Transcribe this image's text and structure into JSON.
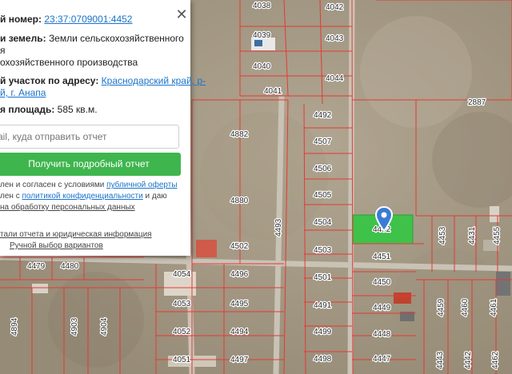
{
  "panel": {
    "cadastral_label": "й номер:",
    "cadastral_value": "23:37:0709001:4452",
    "category_label": "и земель:",
    "category_value_1": "Земли сельскохозяйственного",
    "category_value_2": "я",
    "use_value": "охозяйственного производства",
    "address_label": "й участок по адресу:",
    "address_value_1": "Краснодарский край, р-",
    "address_value_2": "й, г. Анапа",
    "area_label": "я площадь:",
    "area_value": "585 кв.м.",
    "email_placeholder": "ail, куда отправить отчет",
    "submit_label": "Получить подробный отчет",
    "consent_1a": "лен и согласен с условиями ",
    "consent_1b": "публичной оферты",
    "consent_2a": "лен с ",
    "consent_2b": "политикой конфиденциальности",
    "consent_2c": " и даю",
    "consent_3": "на обработку персональных данных",
    "details_link": "тали отчета и юридическая информация",
    "manual_link": "Ручной выбор вариантов"
  },
  "map": {
    "highlight_color": "#3ec24a",
    "boundary_color": "#e53935",
    "parcels": [
      "4038",
      "4042",
      "4039",
      "4043",
      "4040",
      "4044",
      "4041",
      "2887",
      "4492",
      "4882",
      "4507",
      "4506",
      "4880",
      "4505",
      "4504",
      "4452",
      "4502",
      "4493",
      "4503",
      "4451",
      "4453",
      "4431",
      "4455",
      "4479",
      "4480",
      "4054",
      "4496",
      "4501",
      "4450",
      "4053",
      "4495",
      "4491",
      "4449",
      "4459",
      "4460",
      "4461",
      "4894",
      "4903",
      "4904",
      "4052",
      "4494",
      "4499",
      "4448",
      "4051",
      "4497",
      "4498",
      "4447",
      "4443",
      "4442",
      "4462"
    ]
  }
}
